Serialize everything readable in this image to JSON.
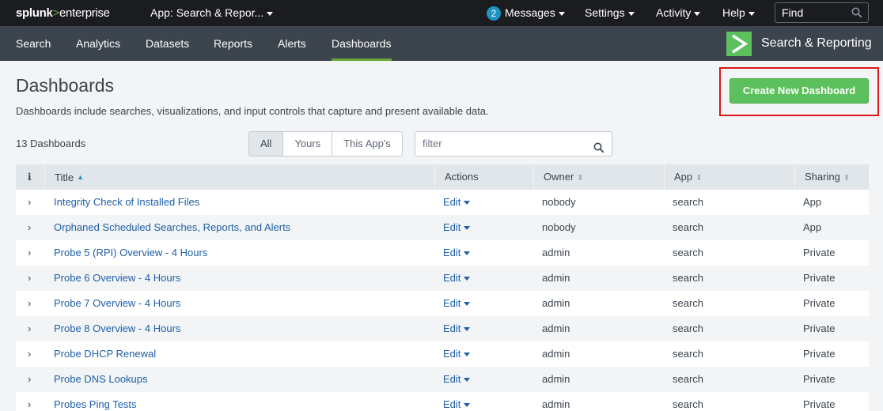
{
  "topbar": {
    "logo_splunk": "splunk",
    "logo_gt": ">",
    "logo_enterprise": "enterprise",
    "app_menu": "App: Search & Repor...",
    "messages_count": "2",
    "messages": "Messages",
    "settings": "Settings",
    "activity": "Activity",
    "help": "Help",
    "find_placeholder": "Find"
  },
  "appbar": {
    "tabs": [
      "Search",
      "Analytics",
      "Datasets",
      "Reports",
      "Alerts",
      "Dashboards"
    ],
    "active_tab": "Dashboards",
    "app_title": "Search & Reporting"
  },
  "page": {
    "title": "Dashboards",
    "description": "Dashboards include searches, visualizations, and input controls that capture and present available data.",
    "create_button": "Create New Dashboard",
    "count": "13 Dashboards",
    "filters": [
      "All",
      "Yours",
      "This App's"
    ],
    "filter_placeholder": "filter"
  },
  "table": {
    "headers": {
      "info": "i",
      "title": "Title",
      "actions": "Actions",
      "owner": "Owner",
      "app": "App",
      "sharing": "Sharing"
    },
    "rows": [
      {
        "title": "Integrity Check of Installed Files",
        "action": "Edit",
        "owner": "nobody",
        "app": "search",
        "sharing": "App"
      },
      {
        "title": "Orphaned Scheduled Searches, Reports, and Alerts",
        "action": "Edit",
        "owner": "nobody",
        "app": "search",
        "sharing": "App"
      },
      {
        "title": "Probe 5 (RPI) Overview - 4 Hours",
        "action": "Edit",
        "owner": "admin",
        "app": "search",
        "sharing": "Private"
      },
      {
        "title": "Probe 6 Overview - 4 Hours",
        "action": "Edit",
        "owner": "admin",
        "app": "search",
        "sharing": "Private"
      },
      {
        "title": "Probe 7 Overview - 4 Hours",
        "action": "Edit",
        "owner": "admin",
        "app": "search",
        "sharing": "Private"
      },
      {
        "title": "Probe 8 Overview - 4 Hours",
        "action": "Edit",
        "owner": "admin",
        "app": "search",
        "sharing": "Private"
      },
      {
        "title": "Probe DHCP Renewal",
        "action": "Edit",
        "owner": "admin",
        "app": "search",
        "sharing": "Private"
      },
      {
        "title": "Probe DNS Lookups",
        "action": "Edit",
        "owner": "admin",
        "app": "search",
        "sharing": "Private"
      },
      {
        "title": "Probes Ping Tests",
        "action": "Edit",
        "owner": "admin",
        "app": "search",
        "sharing": "Private"
      }
    ]
  },
  "colors": {
    "accent_green": "#5cc05c",
    "link_blue": "#1e5fa8",
    "highlight_red": "#d9161c"
  }
}
